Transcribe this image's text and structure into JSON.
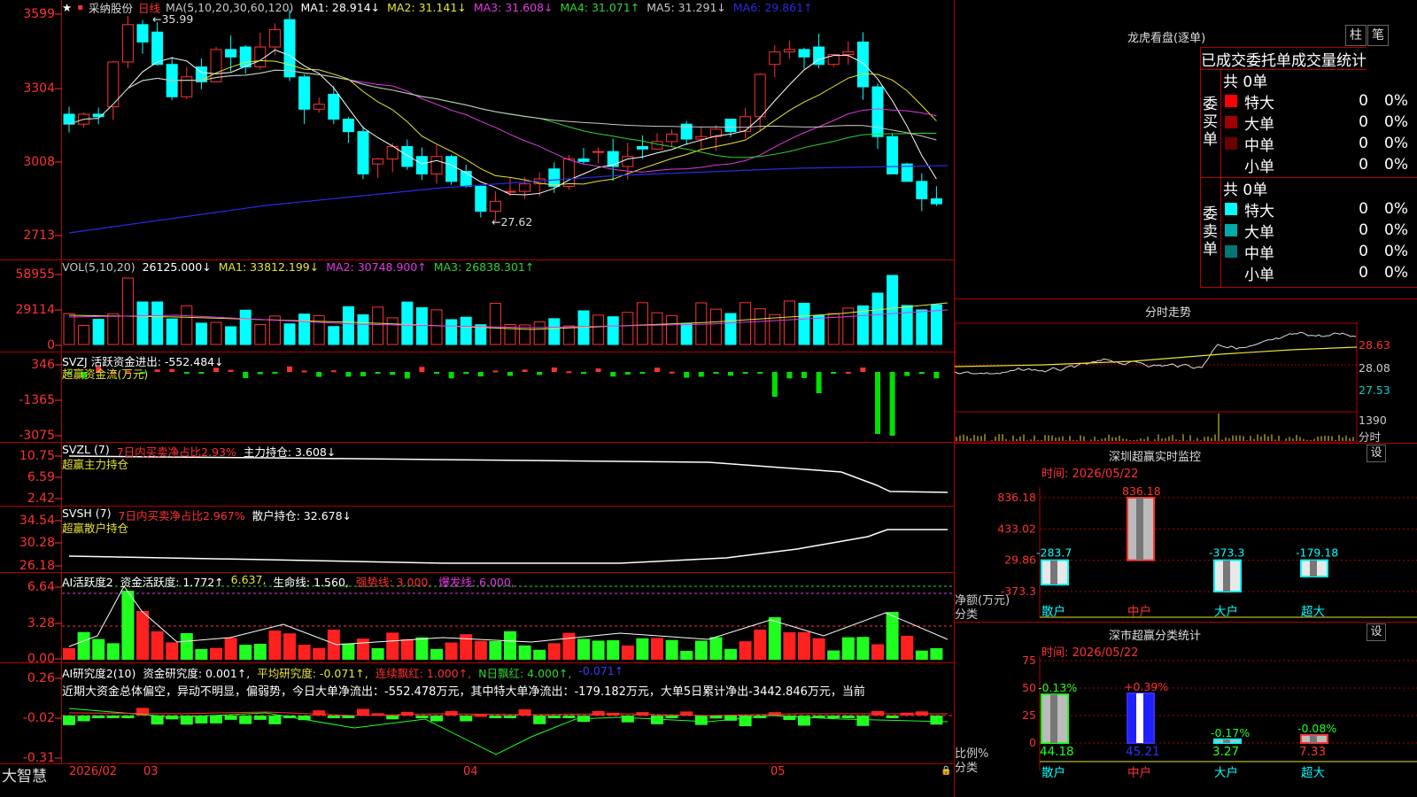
{
  "header": {
    "stock_name": "采纳股份",
    "period": "日线",
    "ma_items": [
      {
        "label": "MA(5,10,20,30,60,120)",
        "color": "#c8c8c8"
      },
      {
        "label": "MA1: 28.914↓",
        "color": "#ffffff"
      },
      {
        "label": "MA2: 31.141↓",
        "color": "#e5e534"
      },
      {
        "label": "MA3: 31.608↓",
        "color": "#e239e2"
      },
      {
        "label": "MA4: 31.071↑",
        "color": "#2fd52f"
      },
      {
        "label": "MA5: 31.291↓",
        "color": "#c8c8c8"
      },
      {
        "label": "MA6: 29.861↑",
        "color": "#2a2ae6"
      }
    ]
  },
  "price_axis": {
    "labels": [
      "3599",
      "3304",
      "3008",
      "2713"
    ]
  },
  "price_annotations": {
    "high": "35.99",
    "low": "27.62"
  },
  "vol_panel": {
    "header": [
      {
        "text": "VOL(5,10,20)",
        "color": "#c8c8c8"
      },
      {
        "text": "26125.000↓",
        "color": "#ffffff"
      },
      {
        "text": "MA1: 33812.199↓",
        "color": "#e5e534"
      },
      {
        "text": "MA2: 30748.900↑",
        "color": "#e239e2"
      },
      {
        "text": "MA3: 26838.301↑",
        "color": "#2fd52f"
      }
    ],
    "axis": [
      "58955",
      "29114",
      "0"
    ]
  },
  "svzj_panel": {
    "header": [
      {
        "text": "SVZJ  活跃资金进出: -552.484↓",
        "color": "#ffffff"
      }
    ],
    "subtitle": "超赢资金流(万元)",
    "axis": [
      "346",
      "-1365",
      "-3075"
    ]
  },
  "svzl_panel": {
    "header": [
      {
        "text": "SVZL (7)",
        "color": "#ffffff"
      },
      {
        "text": "7日内买卖净占比2.93%",
        "color": "#ff3030"
      },
      {
        "text": "主力持仓: 3.608↓",
        "color": "#ffffff"
      }
    ],
    "subtitle": "超赢主力持仓",
    "axis": [
      "10.75",
      "6.59",
      "2.42"
    ]
  },
  "svsh_panel": {
    "header": [
      {
        "text": "SVSH (7)",
        "color": "#ffffff"
      },
      {
        "text": "7日内买卖净占比2.967%",
        "color": "#ff3030"
      },
      {
        "text": "散户持仓: 32.678↓",
        "color": "#ffffff"
      }
    ],
    "subtitle": "超赢散户持仓",
    "axis": [
      "34.54",
      "30.28",
      "26.18"
    ]
  },
  "ai_active_panel": {
    "header": [
      {
        "text": "AI活跃度2",
        "color": "#ffffff"
      },
      {
        "text": "资金活跃度: 1.772↑",
        "color": "#ffffff"
      },
      {
        "text": "6.637,",
        "color": "#e5e534"
      },
      {
        "text": "生命线: 1.560,",
        "color": "#ffffff"
      },
      {
        "text": "强势线: 3.000,",
        "color": "#ff3030"
      },
      {
        "text": "爆发线: 6.000,",
        "color": "#e239e2"
      }
    ],
    "axis": [
      "6.64",
      "3.28",
      "0.00"
    ]
  },
  "ai_research_panel": {
    "header": [
      {
        "text": "AI研究度2(10)",
        "color": "#ffffff"
      },
      {
        "text": "资金研究度: 0.001↑,",
        "color": "#ffffff"
      },
      {
        "text": "平均研究度: -0.071↑,",
        "color": "#e5e534"
      },
      {
        "text": "连续飘红: 1.000↑,",
        "color": "#ff3030"
      },
      {
        "text": "N日飘红: 4.000↑,",
        "color": "#2fd52f"
      },
      {
        "text": "-0.071↑",
        "color": "#3a3aff"
      }
    ],
    "commentary": "近期大资金总体偏空，异动不明显，偏弱势，今日大单净流出：-552.478万元，其中特大单净流出：-179.182万元，大单5日累计净出-3442.846万元，当前",
    "axis": [
      "0.26",
      "-0.02",
      "-0.31"
    ]
  },
  "date_axis": {
    "logo": "大智慧",
    "labels": [
      "2026/02",
      "03",
      "04",
      "05"
    ]
  },
  "dragon_tiger": {
    "title": "龙虎看盘(逐单)",
    "btn_bar": "柱",
    "btn_pen": "笔",
    "tabs": [
      "已成交",
      "委托单",
      "成交量统计"
    ],
    "buy": {
      "side_label": "委买单",
      "total": "共 0单",
      "rows": [
        {
          "label": "特大",
          "count": "0",
          "pct": "0%",
          "color": "#ff0000"
        },
        {
          "label": "大单",
          "count": "0",
          "pct": "0%",
          "color": "#a00000"
        },
        {
          "label": "中单",
          "count": "0",
          "pct": "0%",
          "color": "#6a0000"
        },
        {
          "label": "小单",
          "count": "0",
          "pct": "0%",
          "color": ""
        }
      ]
    },
    "sell": {
      "side_label": "委卖单",
      "total": "共 0单",
      "rows": [
        {
          "label": "特大",
          "count": "0",
          "pct": "0%",
          "color": "#00ffff"
        },
        {
          "label": "大单",
          "count": "0",
          "pct": "0%",
          "color": "#00aaaa"
        },
        {
          "label": "中单",
          "count": "0",
          "pct": "0%",
          "color": "#007777"
        },
        {
          "label": "小单",
          "count": "0",
          "pct": "0%",
          "color": ""
        }
      ]
    }
  },
  "intraday": {
    "title": "分时走势",
    "axis": [
      "28.63",
      "28.08",
      "27.53"
    ],
    "vol_axis": "1390",
    "vol_unit": "分时"
  },
  "sz_monitor": {
    "title": "深圳超赢实时监控",
    "settings": "设",
    "time": "时间: 2026/05/22",
    "axis": [
      "836.18",
      "433.02",
      "29.86",
      "-373.3"
    ],
    "axis_label": "净额(万元)",
    "axis_label2": "分类",
    "chart_data": {
      "type": "bar",
      "categories": [
        "散户",
        "中户",
        "大户",
        "超大"
      ],
      "values": [
        -283.7,
        836.18,
        -373.3,
        -179.18
      ],
      "value_labels": [
        "-283.7",
        "836.18",
        "-373.3",
        "-179.18"
      ],
      "ylabel": "净额(万元)",
      "ylim": [
        -373.3,
        836.18
      ]
    }
  },
  "sz_stats": {
    "title": "深市超赢分类统计",
    "settings": "设",
    "time": "时间: 2026/05/22",
    "axis": [
      "75",
      "50",
      "25",
      "0"
    ],
    "axis_label": "比例%",
    "axis_label2": "分类",
    "chart_data": {
      "type": "bar",
      "categories": [
        "散户",
        "中户",
        "大户",
        "超大"
      ],
      "values": [
        44.18,
        45.21,
        3.27,
        7.33
      ],
      "value_labels": [
        "44.18",
        "45.21",
        "3.27",
        "7.33"
      ],
      "change_labels": [
        "-0.13%",
        "+0.39%",
        "-0.17%",
        "-0.08%"
      ],
      "ylabel": "比例%",
      "ylim": [
        0,
        75
      ]
    }
  },
  "colors": {
    "up": "#ff3232",
    "down": "#00ffff",
    "grid": "#b00000",
    "axis_text": "#ff3232"
  }
}
